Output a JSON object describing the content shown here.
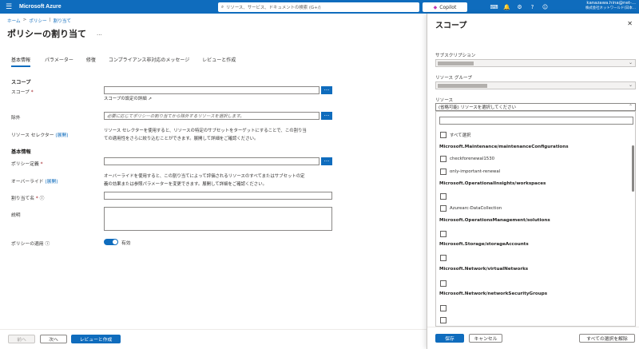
{
  "topbar": {
    "brand": "Microsoft Azure",
    "search_placeholder": "リソース、サービス、ドキュメントの検索 (G+/)",
    "copilot_label": "Copilot",
    "user_name": "kanazawa.hina@net-...",
    "user_tenant": "株式会社ネットワールド(日本...",
    "colors": {
      "bar": "#0f6cbd",
      "accent": "#0f6cbd"
    }
  },
  "breadcrumb": [
    "ホーム",
    "ポリシー",
    "割り当て"
  ],
  "page": {
    "title": "ポリシーの割り当て",
    "more": "..."
  },
  "tabs": [
    "基本情報",
    "パラメーター",
    "修復",
    "コンプライアンス非対応のメッセージ",
    "レビューと作成"
  ],
  "form": {
    "scope_heading": "スコープ",
    "scope_label": "スコープ",
    "scope_link": "スコープの設定の詳細",
    "exclusion_label": "除外",
    "exclusion_placeholder": "必要に応じてポリシーの割り当てから除外するリソースを選択します。",
    "resource_selector_label": "リソース セレクター",
    "expand_label": "(展開)",
    "resource_selector_desc_1": "リソース セレクターを使用すると、リソースの特定のサブセットをターゲットにすることで、この割り当",
    "resource_selector_desc_2": "ての適用性をさらに絞り込むことができます。展開して詳細をご確認ください。",
    "basics_heading": "基本情報",
    "policy_def_label": "ポリシー定義",
    "override_label": "オーバーライド",
    "override_desc_1": "オーバーライドを使用すると、この割り当てによって評価されるリソースのすべてまたはサブセットの定",
    "override_desc_2": "義の効果または参照パラメーターを変更できます。展開して詳細をご確認ください。",
    "assignment_name_label": "割り当て名",
    "description_label": "説明",
    "enforcement_label": "ポリシーの適用",
    "enforcement_value": "有効"
  },
  "footer": {
    "prev": "前へ",
    "next": "次へ",
    "review": "レビューと作成"
  },
  "panel": {
    "title": "スコープ",
    "subscription_label": "サブスクリプション",
    "resource_group_label": "リソース グループ",
    "resource_label": "リソース",
    "resource_placeholder": "(省略可能) リソースを選択してください",
    "select_all": "すべて選択",
    "groups": [
      {
        "name": "Microsoft.Maintenance/maintenanceConfigurations",
        "items": [
          "checkforenewal1530",
          "only-important-renewal"
        ]
      },
      {
        "name": "Microsoft.OperationalInsights/workspaces",
        "items": [
          "",
          "Azurearc-DataCollection"
        ]
      },
      {
        "name": "Microsoft.OperationsManagement/solutions",
        "items": [
          ""
        ]
      },
      {
        "name": "Microsoft.Storage/storageAccounts",
        "items": [
          ""
        ]
      },
      {
        "name": "Microsoft.Network/virtualNetworks",
        "items": [
          ""
        ]
      },
      {
        "name": "Microsoft.Network/networkSecurityGroups",
        "items": [
          ""
        ]
      }
    ],
    "save": "保存",
    "cancel": "キャンセル",
    "clear_all": "すべての選択を解除"
  }
}
